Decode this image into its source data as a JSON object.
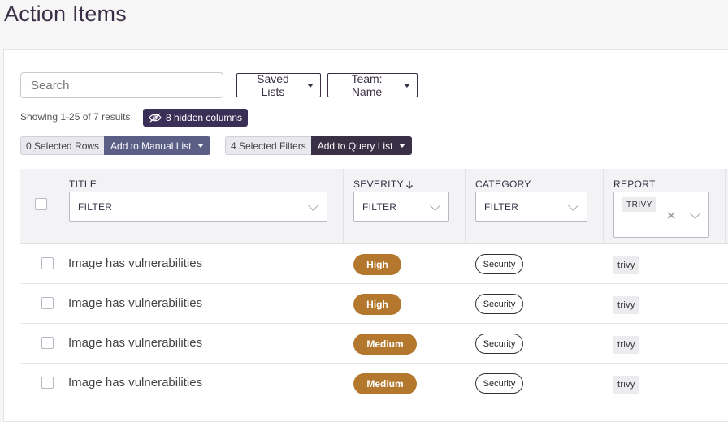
{
  "page": {
    "title": "Action Items"
  },
  "toolbar": {
    "search_placeholder": "Search",
    "saved_lists_label": "Saved Lists",
    "team_label": "Team: Name"
  },
  "results": {
    "summary": "Showing 1-25 of 7 results",
    "hidden_columns": "8 hidden columns"
  },
  "selection": {
    "rows_count": "0 Selected Rows",
    "add_manual": "Add to Manual List",
    "filters_count": "4 Selected Filters",
    "add_query": "Add to Query List"
  },
  "table": {
    "columns": {
      "title": "TITLE",
      "severity": "SEVERITY",
      "category": "CATEGORY",
      "report": "REPORT"
    },
    "filter_placeholder": "FILTER",
    "report_filter_tag": "TRIVY",
    "rows": [
      {
        "title": "Image has vulnerabilities",
        "severity": "High",
        "category": "Security",
        "report": "trivy"
      },
      {
        "title": "Image has vulnerabilities",
        "severity": "High",
        "category": "Security",
        "report": "trivy"
      },
      {
        "title": "Image has vulnerabilities",
        "severity": "Medium",
        "category": "Security",
        "report": "trivy"
      },
      {
        "title": "Image has vulnerabilities",
        "severity": "Medium",
        "category": "Security",
        "report": "trivy"
      }
    ]
  },
  "colors": {
    "brand_dark": "#3a2f45",
    "severity_badge": "#b3782d",
    "mid_button": "#5b5f86"
  }
}
